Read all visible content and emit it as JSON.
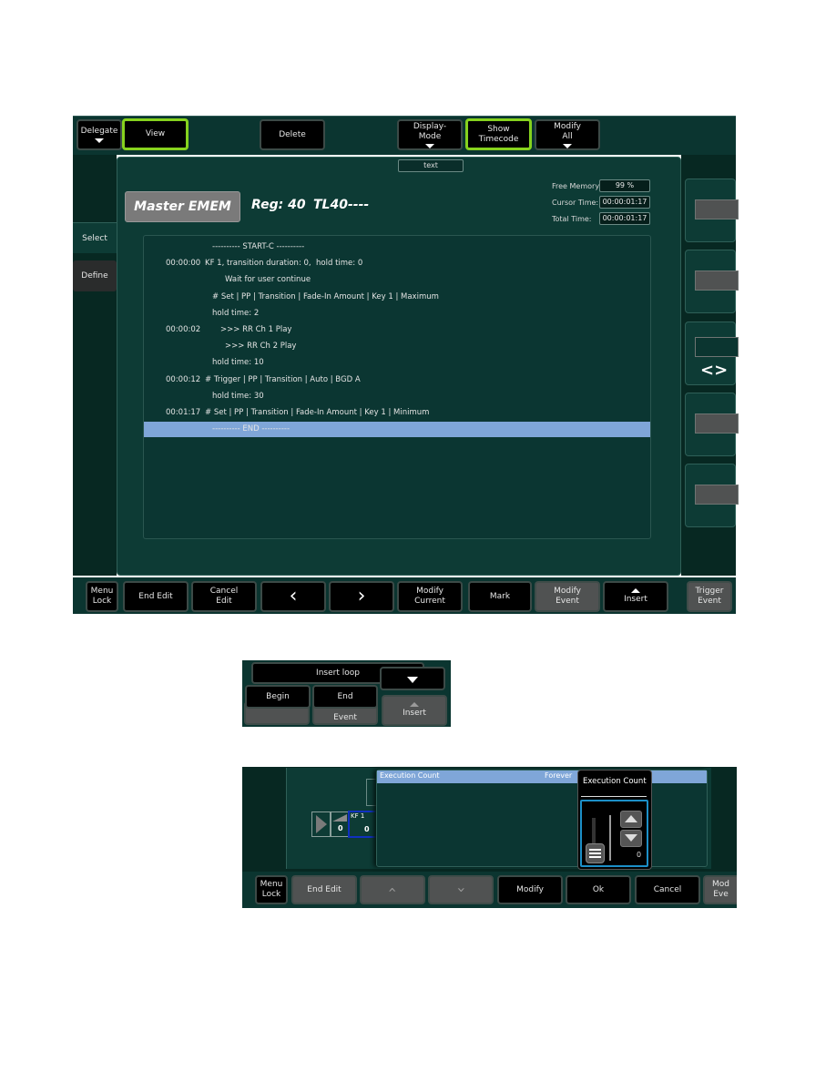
{
  "top_toolbar": {
    "delegate": "Delegate",
    "view": "View",
    "delete": "Delete",
    "display_mode": [
      "Display-",
      "Mode"
    ],
    "show_timecode": [
      "Show",
      "Timecode"
    ],
    "modify_all": [
      "Modify",
      "All"
    ],
    "accent_color": "#86d21e"
  },
  "text_tab": "text",
  "side_tabs": {
    "select": "Select",
    "define": "Define"
  },
  "header": {
    "master_button": "Master EMEM",
    "reg": "Reg: 40",
    "timeline": "TL40----"
  },
  "info": {
    "free_memory_label": "Free Memory",
    "free_memory_value": "99 %",
    "cursor_time_label": "Cursor Time:",
    "cursor_time_value": "00:00:01:17",
    "total_time_label": "Total Time:",
    "total_time_value": "00:00:01:17"
  },
  "event_list": [
    {
      "time": "",
      "text": "---------- START-C ----------",
      "indent": 2
    },
    {
      "time": "00:00:00",
      "text": "KF 1, transition duration: 0,  hold time: 0",
      "indent": 0
    },
    {
      "time": "",
      "text": "Wait for user continue",
      "indent": 3
    },
    {
      "time": "",
      "text": "# Set | PP | Transition | Fade-In Amount | Key 1 | Maximum",
      "indent": 2
    },
    {
      "time": "",
      "text": "hold time: 2",
      "indent": 2
    },
    {
      "time": "00:00:02",
      "text": ">>> RR Ch 1 Play",
      "indent": 1
    },
    {
      "time": "",
      "text": ">>> RR Ch 2 Play",
      "indent": 3
    },
    {
      "time": "",
      "text": "hold time: 10",
      "indent": 2
    },
    {
      "time": "00:00:12",
      "text": "# Trigger | PP | Transition | Auto | BGD A",
      "indent": 0
    },
    {
      "time": "",
      "text": "hold time: 30",
      "indent": 2
    },
    {
      "time": "00:01:17",
      "text": "# Set | PP | Transition | Fade-In Amount | Key 1 | Minimum",
      "indent": 0
    },
    {
      "time": "",
      "text": "---------- END ----------",
      "indent": 2,
      "selected": true
    }
  ],
  "right_panel": {
    "nav_icon": "left-right-chevrons"
  },
  "bottom_toolbar": {
    "menu_lock": [
      "Menu",
      "Lock"
    ],
    "end_edit": "End Edit",
    "cancel_edit": [
      "Cancel",
      "Edit"
    ],
    "prev": "‹",
    "next": "›",
    "modify_current": [
      "Modify",
      "Current"
    ],
    "mark": "Mark",
    "modify_event": [
      "Modify",
      "Event"
    ],
    "insert": "Insert",
    "trigger_event": [
      "Trigger",
      "Event"
    ]
  },
  "insert_popup": {
    "insert_loop": "Insert loop",
    "begin": "Begin",
    "end": "End",
    "event_partial": "Event",
    "insert": "Insert"
  },
  "exec_panel": {
    "kf_label": "KF 1",
    "kf_val1": "0",
    "kf_val2": "0",
    "list_header": "Execution Count",
    "list_value": "Forever",
    "popup_title": "Execution Count",
    "count_value": "0",
    "count_fraction": 0
  },
  "bottom_toolbar2": {
    "menu_lock": [
      "Menu",
      "Lock"
    ],
    "end_edit": "End Edit",
    "modify": "Modify",
    "ok": "Ok",
    "cancel": "Cancel",
    "modify_event_partial": [
      "Mod",
      "Eve"
    ]
  }
}
